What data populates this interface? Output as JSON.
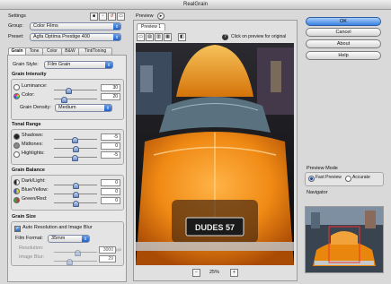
{
  "window": {
    "title": "RealGrain"
  },
  "settings": {
    "heading": "Settings",
    "group_label": "Group:",
    "group_value": "Color Films",
    "preset_label": "Preset:",
    "preset_value": "Agfa Optima Prestige 400"
  },
  "tabs": [
    "Grain",
    "Tone",
    "Color",
    "B&W",
    "Tint/Toning"
  ],
  "grain": {
    "style_label": "Grain Style:",
    "style_value": "Film Grain",
    "intensity_heading": "Grain Intensity",
    "luminance_label": "Luminance:",
    "luminance_value": "30",
    "luminance_level": 0.33,
    "color_label": "Color:",
    "color_value": "20",
    "color_level": 0.22,
    "density_label": "Grain Density:",
    "density_value": "Medium"
  },
  "tonal": {
    "heading": "Tonal Range",
    "shadows_label": "Shadows:",
    "shadows_value": "-5",
    "shadows_level": 0.47,
    "midtones_label": "Midtones:",
    "midtones_value": "0",
    "midtones_level": 0.5,
    "highlights_label": "Highlights:",
    "highlights_value": "-5",
    "highlights_level": 0.47
  },
  "balance": {
    "heading": "Grain Balance",
    "dark_label": "Dark/Light:",
    "dark_value": "0",
    "dark_level": 0.5,
    "blue_label": "Blue/Yellow:",
    "blue_value": "0",
    "blue_level": 0.5,
    "green_label": "Green/Red:",
    "green_value": "0",
    "green_level": 0.5
  },
  "grain_size": {
    "heading": "Grain Size",
    "auto_label": "Auto Resolution and Image Blur",
    "format_label": "Film Format:",
    "format_value": "35mm",
    "resolution_label": "Resolution:",
    "resolution_value": "3000",
    "resolution_unit": "ppi",
    "resolution_level": 0.55,
    "blur_label": "Image Blur:",
    "blur_value": "29",
    "blur_level": 0.35
  },
  "preview": {
    "heading": "Preview",
    "tab_label": "Preview 1",
    "hint": "Click on preview for original",
    "zoom_out": "−",
    "zoom_value": "25%",
    "zoom_in": "+",
    "plate_text": "DUDES 57"
  },
  "buttons": {
    "ok": "OK",
    "cancel": "Cancel",
    "about": "About",
    "help": "Help"
  },
  "preview_mode": {
    "heading": "Preview Mode",
    "fast": "Fast Preview",
    "accurate": "Accurate"
  },
  "navigator": {
    "heading": "Navigator"
  }
}
